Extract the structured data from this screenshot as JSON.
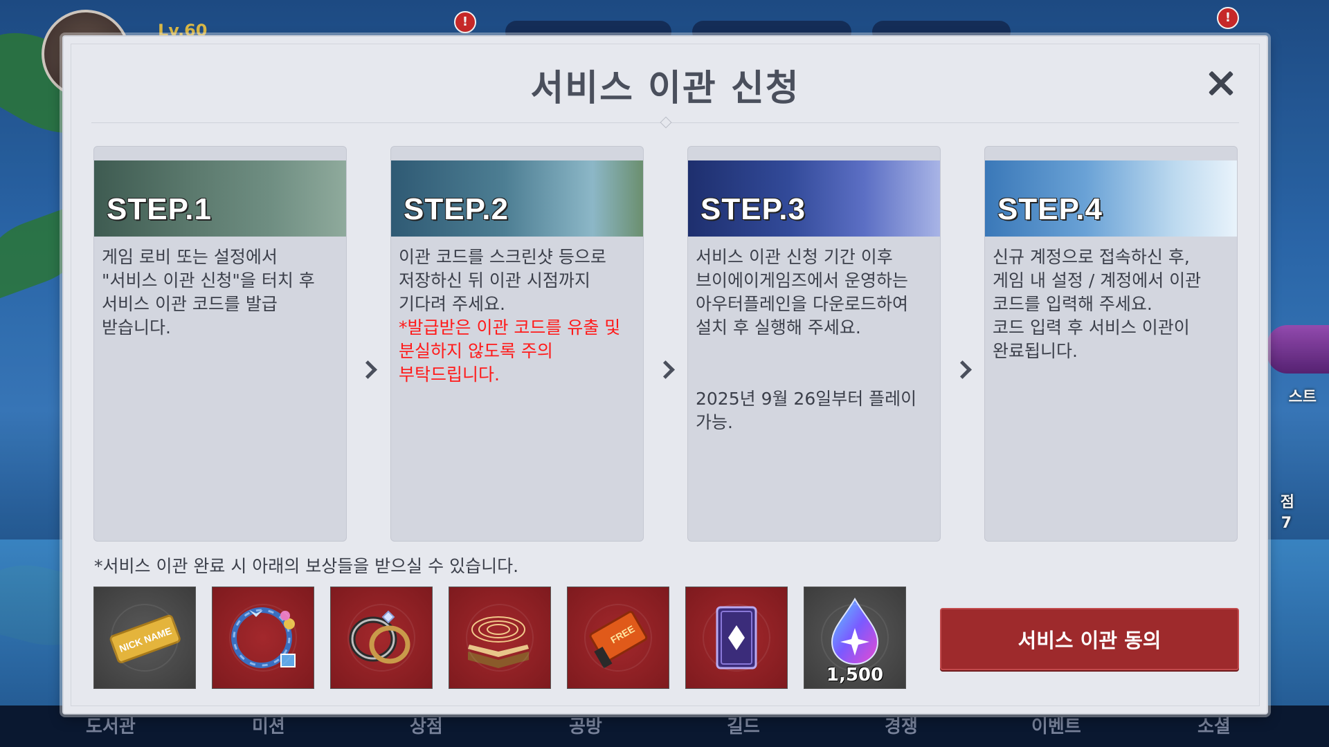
{
  "background": {
    "level_text": "Lv.60",
    "bottom_nav": [
      "도서관",
      "미션",
      "상점",
      "공방",
      "길드",
      "경쟁",
      "이벤트",
      "소셜"
    ],
    "side_text": [
      "스트",
      "점",
      "7"
    ]
  },
  "modal": {
    "title": "서비스 이관 신청",
    "steps": [
      {
        "label": "STEP.1",
        "text": "게임 로비 또는 설정에서\n\"서비스 이관 신청\"을 터치 후\n서비스 이관 코드를 발급\n받습니다."
      },
      {
        "label": "STEP.2",
        "text": "이관 코드를 스크린샷 등으로\n저장하신 뒤 이관 시점까지\n기다려 주세요.",
        "warning": "*발급받은 이관 코드를 유출 및\n분실하지 않도록 주의\n부탁드립니다."
      },
      {
        "label": "STEP.3",
        "text": "서비스 이관 신청 기간 이후\n브이에이게임즈에서 운영하는\n아우터플레인을 다운로드하여\n설치 후 실행해 주세요.",
        "note": "2025년 9월 26일부터 플레이\n가능."
      },
      {
        "label": "STEP.4",
        "text": "신규 계정으로 접속하신 후,\n게임 내 설정 / 계정에서 이관\n코드를 입력해 주세요.\n코드 입력 후 서비스 이관이\n완료됩니다."
      }
    ],
    "reward_note": "*서비스 이관 완료 시 아래의 보상들을 받으실 수 있습니다.",
    "rewards": [
      {
        "icon": "nickname-ticket-icon",
        "bg": "gray",
        "label": "NICK NAME"
      },
      {
        "icon": "wreath-frame-icon",
        "bg": "red"
      },
      {
        "icon": "ring-pair-icon",
        "bg": "red"
      },
      {
        "icon": "magic-book-icon",
        "bg": "red"
      },
      {
        "icon": "free-ticket-icon",
        "bg": "red",
        "label": "FREE"
      },
      {
        "icon": "card-icon",
        "bg": "red"
      },
      {
        "icon": "crystal-icon",
        "bg": "gray",
        "quantity": "1,500"
      }
    ],
    "agree_button": "서비스 이관 동의"
  },
  "colors": {
    "accent_red": "#9e2a2c",
    "warning_red": "#ff1a1a",
    "modal_bg": "#e6e8ee",
    "card_bg": "#d3d6df",
    "text": "#3b3f4a"
  }
}
